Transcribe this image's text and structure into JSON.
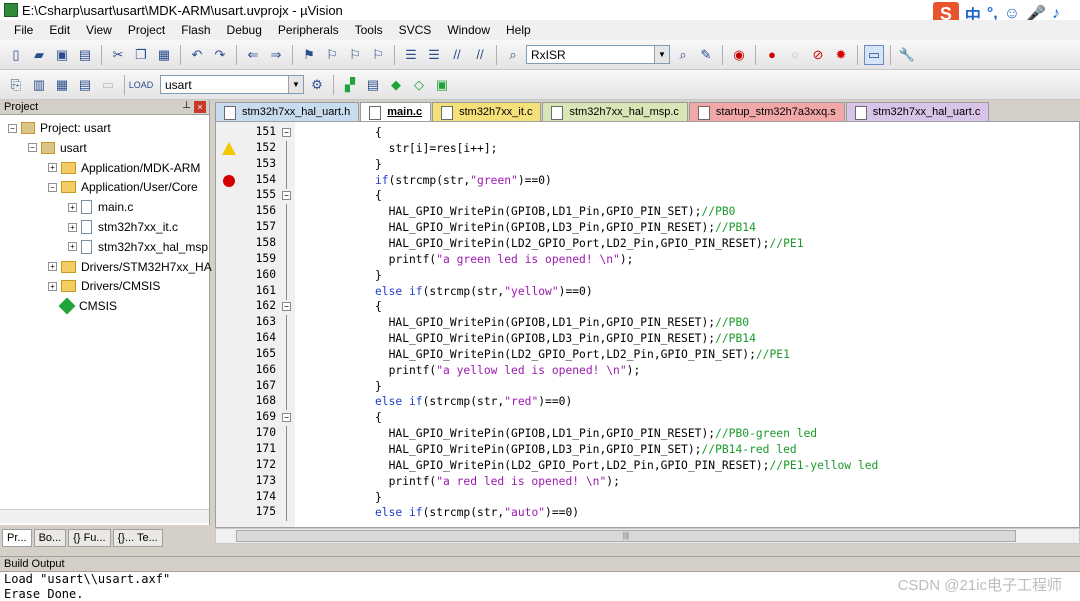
{
  "window": {
    "title": "E:\\Csharp\\usart\\usart\\MDK-ARM\\usart.uvprojx - µVision"
  },
  "ime": {
    "logo": "S",
    "items": [
      "中",
      "°,",
      "☺",
      "🎤",
      "♪"
    ]
  },
  "menubar": {
    "items": [
      "File",
      "Edit",
      "View",
      "Project",
      "Flash",
      "Debug",
      "Peripherals",
      "Tools",
      "SVCS",
      "Window",
      "Help"
    ]
  },
  "toolbar": {
    "find_combo_value": "RxISR",
    "target_combo_value": "usart"
  },
  "project_panel": {
    "title": "Project",
    "tree": [
      {
        "label": "Project: usart",
        "depth": 0,
        "expander": "−",
        "icon": "project-icon"
      },
      {
        "label": "usart",
        "depth": 1,
        "expander": "−",
        "icon": "target-icon"
      },
      {
        "label": "Application/MDK-ARM",
        "depth": 2,
        "expander": "+",
        "icon": "folder-icon"
      },
      {
        "label": "Application/User/Core",
        "depth": 2,
        "expander": "−",
        "icon": "folder-icon"
      },
      {
        "label": "main.c",
        "depth": 3,
        "expander": "+",
        "icon": "file-icon"
      },
      {
        "label": "stm32h7xx_it.c",
        "depth": 3,
        "expander": "+",
        "icon": "file-icon"
      },
      {
        "label": "stm32h7xx_hal_msp",
        "depth": 3,
        "expander": "+",
        "icon": "file-icon"
      },
      {
        "label": "Drivers/STM32H7xx_HA",
        "depth": 2,
        "expander": "+",
        "icon": "folder-icon"
      },
      {
        "label": "Drivers/CMSIS",
        "depth": 2,
        "expander": "+",
        "icon": "folder-icon"
      },
      {
        "label": "CMSIS",
        "depth": 2,
        "expander": "",
        "icon": "gem-icon"
      }
    ],
    "tabs": [
      "Pr...",
      "Bo...",
      "{} Fu...",
      "{}... Te..."
    ]
  },
  "editor_tabs": [
    {
      "label": "stm32h7xx_hal_uart.h",
      "color": "#c9dcef",
      "active": false
    },
    {
      "label": "main.c",
      "color": "#ffffff",
      "active": true
    },
    {
      "label": "stm32h7xx_it.c",
      "color": "#f6e07a",
      "active": false
    },
    {
      "label": "stm32h7xx_hal_msp.c",
      "color": "#d9e7b8",
      "active": false
    },
    {
      "label": "startup_stm32h7a3xxq.s",
      "color": "#f2a8a8",
      "active": false
    },
    {
      "label": "stm32h7xx_hal_uart.c",
      "color": "#d7c4e8",
      "active": false
    }
  ],
  "code_lines": [
    {
      "n": "151",
      "fold": "−",
      "marker": "",
      "segs": [
        [
          "",
          "{"
        ]
      ],
      "indent": 0
    },
    {
      "n": "152",
      "fold": "",
      "marker": "warn",
      "segs": [
        [
          "",
          "  str[i]=res[i++];"
        ]
      ],
      "indent": 0
    },
    {
      "n": "153",
      "fold": "",
      "marker": "",
      "segs": [
        [
          "",
          "}"
        ]
      ],
      "indent": 0
    },
    {
      "n": "154",
      "fold": "",
      "marker": "bp",
      "segs": [
        [
          "kw",
          "if"
        ],
        [
          "",
          "(strcmp(str,"
        ],
        [
          "str",
          "\"green\""
        ],
        [
          "",
          ")==0)"
        ]
      ],
      "indent": 0
    },
    {
      "n": "155",
      "fold": "−",
      "marker": "",
      "segs": [
        [
          "",
          "{"
        ]
      ],
      "indent": 0
    },
    {
      "n": "156",
      "fold": "",
      "marker": "",
      "segs": [
        [
          "",
          "  HAL_GPIO_WritePin(GPIOB,LD1_Pin,GPIO_PIN_SET);"
        ],
        [
          "cm",
          "//PB0"
        ]
      ],
      "indent": 0
    },
    {
      "n": "157",
      "fold": "",
      "marker": "",
      "segs": [
        [
          "",
          "  HAL_GPIO_WritePin(GPIOB,LD3_Pin,GPIO_PIN_RESET);"
        ],
        [
          "cm",
          "//PB14"
        ]
      ],
      "indent": 0
    },
    {
      "n": "158",
      "fold": "",
      "marker": "",
      "segs": [
        [
          "",
          "  HAL_GPIO_WritePin(LD2_GPIO_Port,LD2_Pin,GPIO_PIN_RESET);"
        ],
        [
          "cm",
          "//PE1"
        ]
      ],
      "indent": 0
    },
    {
      "n": "159",
      "fold": "",
      "marker": "",
      "segs": [
        [
          "",
          "  printf("
        ],
        [
          "str",
          "\"a green led is opened! \\n\""
        ],
        [
          "",
          ");"
        ]
      ],
      "indent": 0
    },
    {
      "n": "160",
      "fold": "",
      "marker": "",
      "segs": [
        [
          "",
          "}"
        ]
      ],
      "indent": 0
    },
    {
      "n": "161",
      "fold": "",
      "marker": "",
      "segs": [
        [
          "kw",
          "else if"
        ],
        [
          "",
          "(strcmp(str,"
        ],
        [
          "str",
          "\"yellow\""
        ],
        [
          "",
          ")==0)"
        ]
      ],
      "indent": 0
    },
    {
      "n": "162",
      "fold": "−",
      "marker": "",
      "segs": [
        [
          "",
          "{"
        ]
      ],
      "indent": 0
    },
    {
      "n": "163",
      "fold": "",
      "marker": "",
      "segs": [
        [
          "",
          "  HAL_GPIO_WritePin(GPIOB,LD1_Pin,GPIO_PIN_RESET);"
        ],
        [
          "cm",
          "//PB0"
        ]
      ],
      "indent": 0
    },
    {
      "n": "164",
      "fold": "",
      "marker": "",
      "segs": [
        [
          "",
          "  HAL_GPIO_WritePin(GPIOB,LD3_Pin,GPIO_PIN_RESET);"
        ],
        [
          "cm",
          "//PB14"
        ]
      ],
      "indent": 0
    },
    {
      "n": "165",
      "fold": "",
      "marker": "",
      "segs": [
        [
          "",
          "  HAL_GPIO_WritePin(LD2_GPIO_Port,LD2_Pin,GPIO_PIN_SET);"
        ],
        [
          "cm",
          "//PE1"
        ]
      ],
      "indent": 0
    },
    {
      "n": "166",
      "fold": "",
      "marker": "",
      "segs": [
        [
          "",
          "  printf("
        ],
        [
          "str",
          "\"a yellow led is opened! \\n\""
        ],
        [
          "",
          ");"
        ]
      ],
      "indent": 0
    },
    {
      "n": "167",
      "fold": "",
      "marker": "",
      "segs": [
        [
          "",
          "}"
        ]
      ],
      "indent": 0
    },
    {
      "n": "168",
      "fold": "",
      "marker": "",
      "segs": [
        [
          "kw",
          "else if"
        ],
        [
          "",
          "(strcmp(str,"
        ],
        [
          "str",
          "\"red\""
        ],
        [
          "",
          ")==0)"
        ]
      ],
      "indent": 0
    },
    {
      "n": "169",
      "fold": "−",
      "marker": "",
      "segs": [
        [
          "",
          "{"
        ]
      ],
      "indent": 0
    },
    {
      "n": "170",
      "fold": "",
      "marker": "",
      "segs": [
        [
          "",
          "  HAL_GPIO_WritePin(GPIOB,LD1_Pin,GPIO_PIN_RESET);"
        ],
        [
          "cm",
          "//PB0-green led"
        ]
      ],
      "indent": 0
    },
    {
      "n": "171",
      "fold": "",
      "marker": "",
      "segs": [
        [
          "",
          "  HAL_GPIO_WritePin(GPIOB,LD3_Pin,GPIO_PIN_SET);"
        ],
        [
          "cm",
          "//PB14-red led"
        ]
      ],
      "indent": 0
    },
    {
      "n": "172",
      "fold": "",
      "marker": "",
      "segs": [
        [
          "",
          "  HAL_GPIO_WritePin(LD2_GPIO_Port,LD2_Pin,GPIO_PIN_RESET);"
        ],
        [
          "cm",
          "//PE1-yellow led"
        ]
      ],
      "indent": 0
    },
    {
      "n": "173",
      "fold": "",
      "marker": "",
      "segs": [
        [
          "",
          "  printf("
        ],
        [
          "str",
          "\"a red led is opened! \\n\""
        ],
        [
          "",
          ");"
        ]
      ],
      "indent": 0
    },
    {
      "n": "174",
      "fold": "",
      "marker": "",
      "segs": [
        [
          "",
          "}"
        ]
      ],
      "indent": 0
    },
    {
      "n": "175",
      "fold": "",
      "marker": "",
      "segs": [
        [
          "kw",
          "else if"
        ],
        [
          "",
          "(strcmp(str,"
        ],
        [
          "str",
          "\"auto\""
        ],
        [
          "",
          ")==0)"
        ]
      ],
      "indent": 0
    }
  ],
  "build_output": {
    "title": "Build Output",
    "lines": [
      "Load \"usart\\\\usart.axf\"",
      "Erase Done."
    ]
  },
  "watermark": "CSDN @21ic电子工程师"
}
